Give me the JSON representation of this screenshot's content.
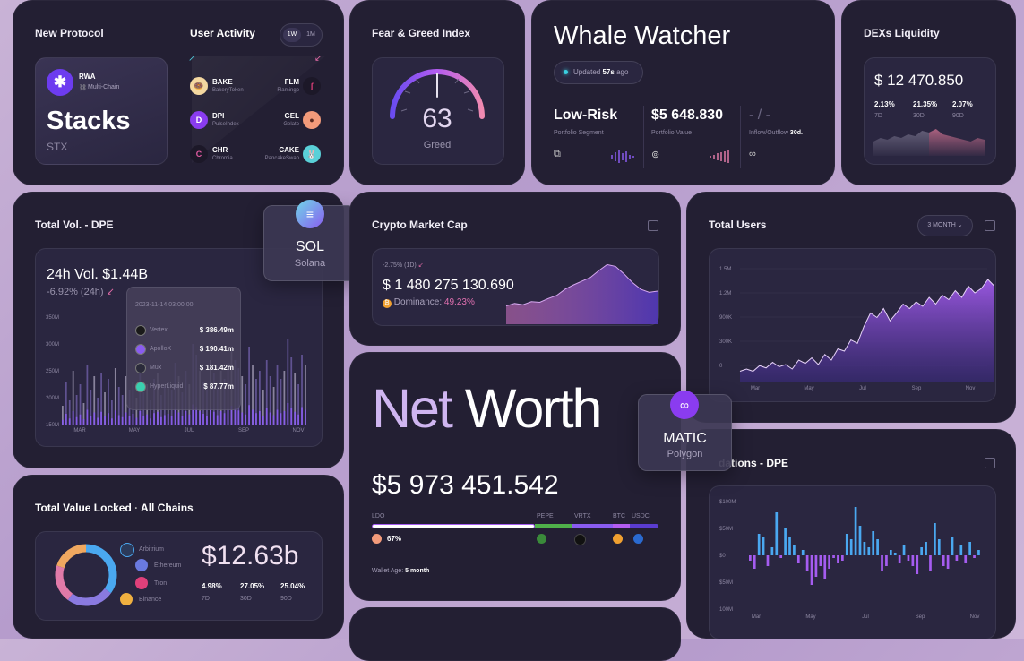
{
  "new_protocol": {
    "title": "New Protocol",
    "tag": "RWA",
    "chain": "Multi-Chain",
    "name": "Stacks",
    "ticker": "STX"
  },
  "user_activity": {
    "title": "User Activity",
    "tabs": [
      "1W",
      "1M"
    ],
    "left": [
      {
        "sym": "BAKE",
        "name": "BakeryToken"
      },
      {
        "sym": "DPI",
        "name": "PulseIndex"
      },
      {
        "sym": "CHR",
        "name": "Chromia"
      }
    ],
    "right": [
      {
        "sym": "FLM",
        "name": "Flamingo"
      },
      {
        "sym": "GEL",
        "name": "Gelato"
      },
      {
        "sym": "CAKE",
        "name": "PancakeSwap"
      }
    ]
  },
  "fear_greed": {
    "title": "Fear & Greed Index",
    "value": "63",
    "label": "Greed"
  },
  "whale": {
    "title": "Whale Watcher",
    "updated_prefix": "Updated",
    "updated_value": "57s",
    "updated_suffix": "ago",
    "risk": "Low-Risk",
    "risk_label": "Portfolio Segment",
    "value": "$5 648.830",
    "value_label": "Portfolio Value",
    "flow": "- / -",
    "flow_label": "Inflow/Outflow",
    "flow_period": "30d."
  },
  "dex": {
    "title": "DEXs Liquidity",
    "value": "$ 12 470.850",
    "stats": [
      {
        "pct": "2.13%",
        "period": "7D"
      },
      {
        "pct": "21.35%",
        "period": "30D"
      },
      {
        "pct": "2.07%",
        "period": "90D"
      }
    ]
  },
  "total_vol": {
    "title": "Total Vol. - DPE",
    "headline": "24h Vol. $1.44B",
    "change": "-6.92% (24h)",
    "y_ticks": [
      "350M",
      "300M",
      "250M",
      "200M",
      "150M"
    ],
    "x_ticks": [
      "MAR",
      "MAY",
      "JUL",
      "SEP",
      "NOV"
    ],
    "tooltip": {
      "date": "2023-11-14 03:00:00",
      "rows": [
        {
          "name": "Vertex",
          "value": "$ 386.49m"
        },
        {
          "name": "ApolloX",
          "value": "$ 190.41m"
        },
        {
          "name": "Mux",
          "value": "$ 181.42m"
        },
        {
          "name": "HyperLiquid",
          "value": "$ 87.77m"
        }
      ]
    }
  },
  "sol": {
    "sym": "SOL",
    "name": "Solana"
  },
  "matic": {
    "sym": "MATIC",
    "name": "Polygon"
  },
  "market_cap": {
    "title": "Crypto Market Cap",
    "change": "-2.75% (1D)",
    "value": "$ 1 480 275 130.690",
    "dominance_label": "Dominance:",
    "dominance_value": "49.23%"
  },
  "total_users": {
    "title": "Total Users",
    "range": "3 MONTH",
    "y_ticks": [
      "1.5M",
      "1.2M",
      "900K",
      "300K",
      "0"
    ],
    "x_ticks": [
      "Mar",
      "May",
      "Jul",
      "Sep",
      "Nov"
    ]
  },
  "net_worth": {
    "title_a": "Net",
    "title_b": "Worth",
    "value": "$5 973 451.542",
    "tokens": [
      "LDO",
      "PEPE",
      "VRTX",
      "BTC",
      "USDC"
    ],
    "ldo_pct": "67%",
    "wallet_age_label": "Wallet Age:",
    "wallet_age_value": "5 month"
  },
  "tvl": {
    "title": "Total Value Locked",
    "subtitle": "All Chains",
    "value": "$12.63b",
    "chains": [
      "Arbitrium",
      "Ethereum",
      "Tron",
      "Binance"
    ],
    "stats": [
      {
        "pct": "4.98%",
        "period": "7D"
      },
      {
        "pct": "27.05%",
        "period": "30D"
      },
      {
        "pct": "25.04%",
        "period": "90D"
      }
    ]
  },
  "liquidations": {
    "title": "dations - DPE",
    "y_ticks": [
      "$100M",
      "$50M",
      "$0",
      "$50M",
      "100M"
    ],
    "x_ticks": [
      "Mar",
      "May",
      "Jul",
      "Sep",
      "Nov"
    ]
  },
  "colors": {
    "accent": "#a55cf0",
    "pink": "#e07aa8",
    "blue": "#4aa8f0",
    "bg": "#231f33"
  },
  "chart_data": [
    {
      "type": "bar",
      "title": "Total Vol. - DPE",
      "x": [
        "MAR",
        "MAY",
        "JUL",
        "SEP",
        "NOV"
      ],
      "ylim": [
        150,
        350
      ],
      "ylabel": "",
      "xlabel": "",
      "values": [
        185,
        230,
        195,
        250,
        205,
        225,
        190,
        260,
        215,
        240,
        200,
        245,
        210,
        235,
        195,
        255,
        220,
        205,
        240,
        215,
        230,
        200,
        250,
        210,
        225,
        195,
        235,
        245,
        205,
        220,
        230,
        215,
        265,
        240,
        210,
        250,
        225,
        300,
        280,
        250,
        230,
        215,
        270,
        245,
        220,
        250,
        235,
        265,
        290,
        270,
        255,
        240,
        225,
        295,
        260,
        235,
        250,
        215,
        270,
        240,
        220,
        260,
        235,
        250,
        310,
        275,
        245,
        225,
        280,
        260
      ]
    },
    {
      "type": "area",
      "title": "Crypto Market Cap",
      "values": [
        0.18,
        0.22,
        0.2,
        0.25,
        0.24,
        0.3,
        0.35,
        0.45,
        0.52,
        0.58,
        0.64,
        0.75,
        0.85,
        0.82,
        0.7,
        0.56,
        0.45,
        0.4,
        0.42
      ]
    },
    {
      "type": "area",
      "title": "Total Users",
      "x": [
        "Mar",
        "May",
        "Jul",
        "Sep",
        "Nov"
      ],
      "values": [
        0.1,
        0.12,
        0.1,
        0.15,
        0.13,
        0.18,
        0.14,
        0.16,
        0.12,
        0.2,
        0.17,
        0.22,
        0.16,
        0.25,
        0.2,
        0.3,
        0.28,
        0.38,
        0.35,
        0.5,
        0.62,
        0.58,
        0.66,
        0.55,
        0.62,
        0.7,
        0.66,
        0.72,
        0.68,
        0.76,
        0.7,
        0.78,
        0.74,
        0.82,
        0.76,
        0.86,
        0.8,
        0.84,
        0.92,
        0.86
      ]
    },
    {
      "type": "bar",
      "title": "Liquidations - DPE",
      "x": [
        "Mar",
        "May",
        "Jul",
        "Sep",
        "Nov"
      ],
      "ylim": [
        -100,
        100
      ],
      "values": [
        -10,
        -25,
        40,
        35,
        -20,
        15,
        80,
        -5,
        50,
        35,
        20,
        -15,
        10,
        -30,
        -55,
        -40,
        -20,
        -45,
        -25,
        -5,
        -15,
        -10,
        40,
        30,
        90,
        55,
        25,
        15,
        45,
        30,
        -30,
        -20,
        10,
        5,
        -15,
        20,
        -10,
        -20,
        -35,
        15,
        25,
        -30,
        60,
        30,
        -20,
        -25,
        35,
        -10,
        20,
        -15,
        25,
        -5,
        10
      ]
    },
    {
      "type": "pie",
      "title": "Total Value Locked",
      "categories": [
        "Arbitrium",
        "Ethereum",
        "Tron",
        "Binance"
      ],
      "values": [
        35,
        25,
        20,
        20
      ]
    },
    {
      "type": "area",
      "title": "DEXs Liquidity",
      "values": [
        0.4,
        0.5,
        0.45,
        0.55,
        0.5,
        0.6,
        0.55,
        0.7,
        0.65,
        0.75,
        0.6,
        0.55,
        0.5,
        0.45,
        0.4,
        0.5,
        0.45
      ]
    }
  ]
}
